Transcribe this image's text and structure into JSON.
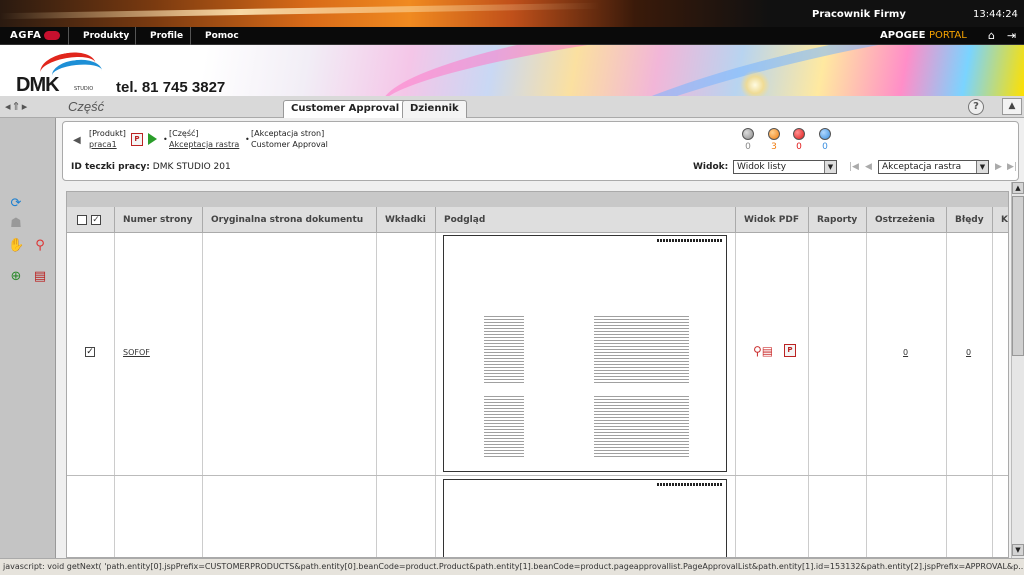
{
  "header": {
    "user_name": "Pracownik Firmy",
    "clock": "13:44:24",
    "logo": "AGFA",
    "menu": [
      "Produkty",
      "Profile",
      "Pomoc"
    ],
    "brand_left": "APOGEE",
    "brand_right": "PORTAL"
  },
  "banner": {
    "company": "DMK",
    "company_sub": "STUDIO",
    "phone": "tel. 81 745 3827"
  },
  "title_row": {
    "page_title": "Część",
    "tabs": [
      {
        "label": "Customer Approval",
        "active": true
      },
      {
        "label": "Dziennik",
        "active": false
      }
    ]
  },
  "breadcrumb": {
    "product_label": "[Produkt]",
    "product_link": "praca1",
    "part_label": "[Część]",
    "part_link": "Akceptacja rastra",
    "approval_label": "[Akceptacja stron]",
    "approval_value": "Customer Approval"
  },
  "job": {
    "id_label": "ID teczki pracy:",
    "id_value": "DMK STUDIO 201"
  },
  "status_counts": [
    {
      "color": "#8c8c8c",
      "count": "0"
    },
    {
      "color": "#f07d10",
      "count": "3"
    },
    {
      "color": "#e01818",
      "count": "0"
    },
    {
      "color": "#3a8fe0",
      "count": "0"
    }
  ],
  "view": {
    "label": "Widok:",
    "selected": "Widok listy",
    "stage_selected": "Akceptacja rastra"
  },
  "table": {
    "columns": [
      "Numer strony",
      "Oryginalna strona dokumentu",
      "Wkładki",
      "Podgląd",
      "Widok PDF",
      "Raporty",
      "Ostrzeżenia",
      "Błędy",
      "Ko"
    ],
    "rows": [
      {
        "checked": true,
        "page_number": "SOFOF",
        "warnings": "0",
        "errors": "0"
      }
    ]
  },
  "statusbar": {
    "text": "javascript: void getNext( 'path.entity[0].jspPrefix=CUSTOMERPRODUCTS&path.entity[0].beanCode=product.Product&path.entity[1].beanCode=product.pageapprovallist.PageApprovalList&path.entity[1].id=153132&path.entity[2].jspPrefix=APPROVAL&p..."
  },
  "icons": {
    "home": "home-icon",
    "logout": "logout-icon",
    "help": "help-icon"
  }
}
